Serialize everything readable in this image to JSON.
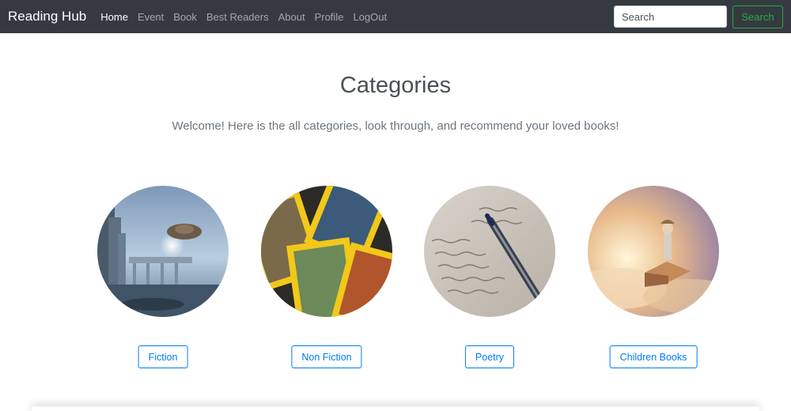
{
  "navbar": {
    "brand": "Reading Hub",
    "links": [
      "Home",
      "Event",
      "Book",
      "Best Readers",
      "About",
      "Profile",
      "LogOut"
    ],
    "search_placeholder": "Search",
    "search_button": "Search"
  },
  "page": {
    "title": "Categories",
    "lead": "Welcome! Here is the all categories, look through, and recommend your loved books!"
  },
  "categories": [
    {
      "label": "Fiction",
      "image": "futuristic-city-spaceship-image"
    },
    {
      "label": "Non Fiction",
      "image": "national-geographic-magazines-image"
    },
    {
      "label": "Poetry",
      "image": "pen-on-handwritten-paper-image"
    },
    {
      "label": "Children Books",
      "image": "child-reading-open-book-image"
    }
  ],
  "colors": {
    "navbar_bg": "#343a40",
    "search_outline": "#28a745",
    "category_outline": "#007bff"
  }
}
